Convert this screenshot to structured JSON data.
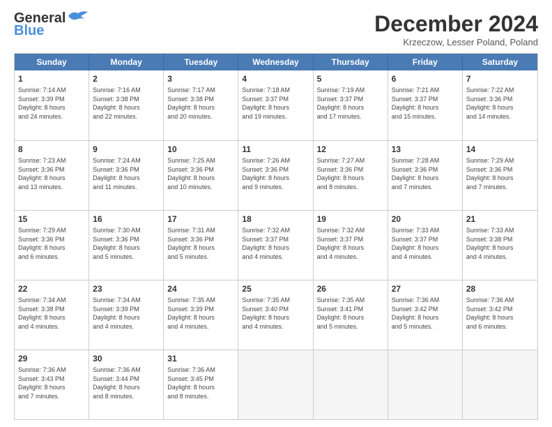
{
  "header": {
    "logo_line1": "General",
    "logo_line2": "Blue",
    "month": "December 2024",
    "location": "Krzeczow, Lesser Poland, Poland"
  },
  "days_of_week": [
    "Sunday",
    "Monday",
    "Tuesday",
    "Wednesday",
    "Thursday",
    "Friday",
    "Saturday"
  ],
  "weeks": [
    [
      {
        "day": "1",
        "lines": [
          "Sunrise: 7:14 AM",
          "Sunset: 3:39 PM",
          "Daylight: 8 hours",
          "and 24 minutes."
        ]
      },
      {
        "day": "2",
        "lines": [
          "Sunrise: 7:16 AM",
          "Sunset: 3:38 PM",
          "Daylight: 8 hours",
          "and 22 minutes."
        ]
      },
      {
        "day": "3",
        "lines": [
          "Sunrise: 7:17 AM",
          "Sunset: 3:38 PM",
          "Daylight: 8 hours",
          "and 20 minutes."
        ]
      },
      {
        "day": "4",
        "lines": [
          "Sunrise: 7:18 AM",
          "Sunset: 3:37 PM",
          "Daylight: 8 hours",
          "and 19 minutes."
        ]
      },
      {
        "day": "5",
        "lines": [
          "Sunrise: 7:19 AM",
          "Sunset: 3:37 PM",
          "Daylight: 8 hours",
          "and 17 minutes."
        ]
      },
      {
        "day": "6",
        "lines": [
          "Sunrise: 7:21 AM",
          "Sunset: 3:37 PM",
          "Daylight: 8 hours",
          "and 15 minutes."
        ]
      },
      {
        "day": "7",
        "lines": [
          "Sunrise: 7:22 AM",
          "Sunset: 3:36 PM",
          "Daylight: 8 hours",
          "and 14 minutes."
        ]
      }
    ],
    [
      {
        "day": "8",
        "lines": [
          "Sunrise: 7:23 AM",
          "Sunset: 3:36 PM",
          "Daylight: 8 hours",
          "and 13 minutes."
        ]
      },
      {
        "day": "9",
        "lines": [
          "Sunrise: 7:24 AM",
          "Sunset: 3:36 PM",
          "Daylight: 8 hours",
          "and 11 minutes."
        ]
      },
      {
        "day": "10",
        "lines": [
          "Sunrise: 7:25 AM",
          "Sunset: 3:36 PM",
          "Daylight: 8 hours",
          "and 10 minutes."
        ]
      },
      {
        "day": "11",
        "lines": [
          "Sunrise: 7:26 AM",
          "Sunset: 3:36 PM",
          "Daylight: 8 hours",
          "and 9 minutes."
        ]
      },
      {
        "day": "12",
        "lines": [
          "Sunrise: 7:27 AM",
          "Sunset: 3:36 PM",
          "Daylight: 8 hours",
          "and 8 minutes."
        ]
      },
      {
        "day": "13",
        "lines": [
          "Sunrise: 7:28 AM",
          "Sunset: 3:36 PM",
          "Daylight: 8 hours",
          "and 7 minutes."
        ]
      },
      {
        "day": "14",
        "lines": [
          "Sunrise: 7:29 AM",
          "Sunset: 3:36 PM",
          "Daylight: 8 hours",
          "and 7 minutes."
        ]
      }
    ],
    [
      {
        "day": "15",
        "lines": [
          "Sunrise: 7:29 AM",
          "Sunset: 3:36 PM",
          "Daylight: 8 hours",
          "and 6 minutes."
        ]
      },
      {
        "day": "16",
        "lines": [
          "Sunrise: 7:30 AM",
          "Sunset: 3:36 PM",
          "Daylight: 8 hours",
          "and 5 minutes."
        ]
      },
      {
        "day": "17",
        "lines": [
          "Sunrise: 7:31 AM",
          "Sunset: 3:36 PM",
          "Daylight: 8 hours",
          "and 5 minutes."
        ]
      },
      {
        "day": "18",
        "lines": [
          "Sunrise: 7:32 AM",
          "Sunset: 3:37 PM",
          "Daylight: 8 hours",
          "and 4 minutes."
        ]
      },
      {
        "day": "19",
        "lines": [
          "Sunrise: 7:32 AM",
          "Sunset: 3:37 PM",
          "Daylight: 8 hours",
          "and 4 minutes."
        ]
      },
      {
        "day": "20",
        "lines": [
          "Sunrise: 7:33 AM",
          "Sunset: 3:37 PM",
          "Daylight: 8 hours",
          "and 4 minutes."
        ]
      },
      {
        "day": "21",
        "lines": [
          "Sunrise: 7:33 AM",
          "Sunset: 3:38 PM",
          "Daylight: 8 hours",
          "and 4 minutes."
        ]
      }
    ],
    [
      {
        "day": "22",
        "lines": [
          "Sunrise: 7:34 AM",
          "Sunset: 3:38 PM",
          "Daylight: 8 hours",
          "and 4 minutes."
        ]
      },
      {
        "day": "23",
        "lines": [
          "Sunrise: 7:34 AM",
          "Sunset: 3:39 PM",
          "Daylight: 8 hours",
          "and 4 minutes."
        ]
      },
      {
        "day": "24",
        "lines": [
          "Sunrise: 7:35 AM",
          "Sunset: 3:39 PM",
          "Daylight: 8 hours",
          "and 4 minutes."
        ]
      },
      {
        "day": "25",
        "lines": [
          "Sunrise: 7:35 AM",
          "Sunset: 3:40 PM",
          "Daylight: 8 hours",
          "and 4 minutes."
        ]
      },
      {
        "day": "26",
        "lines": [
          "Sunrise: 7:35 AM",
          "Sunset: 3:41 PM",
          "Daylight: 8 hours",
          "and 5 minutes."
        ]
      },
      {
        "day": "27",
        "lines": [
          "Sunrise: 7:36 AM",
          "Sunset: 3:42 PM",
          "Daylight: 8 hours",
          "and 5 minutes."
        ]
      },
      {
        "day": "28",
        "lines": [
          "Sunrise: 7:36 AM",
          "Sunset: 3:42 PM",
          "Daylight: 8 hours",
          "and 6 minutes."
        ]
      }
    ],
    [
      {
        "day": "29",
        "lines": [
          "Sunrise: 7:36 AM",
          "Sunset: 3:43 PM",
          "Daylight: 8 hours",
          "and 7 minutes."
        ]
      },
      {
        "day": "30",
        "lines": [
          "Sunrise: 7:36 AM",
          "Sunset: 3:44 PM",
          "Daylight: 8 hours",
          "and 8 minutes."
        ]
      },
      {
        "day": "31",
        "lines": [
          "Sunrise: 7:36 AM",
          "Sunset: 3:45 PM",
          "Daylight: 8 hours",
          "and 8 minutes."
        ]
      },
      {
        "day": "",
        "lines": []
      },
      {
        "day": "",
        "lines": []
      },
      {
        "day": "",
        "lines": []
      },
      {
        "day": "",
        "lines": []
      }
    ]
  ]
}
